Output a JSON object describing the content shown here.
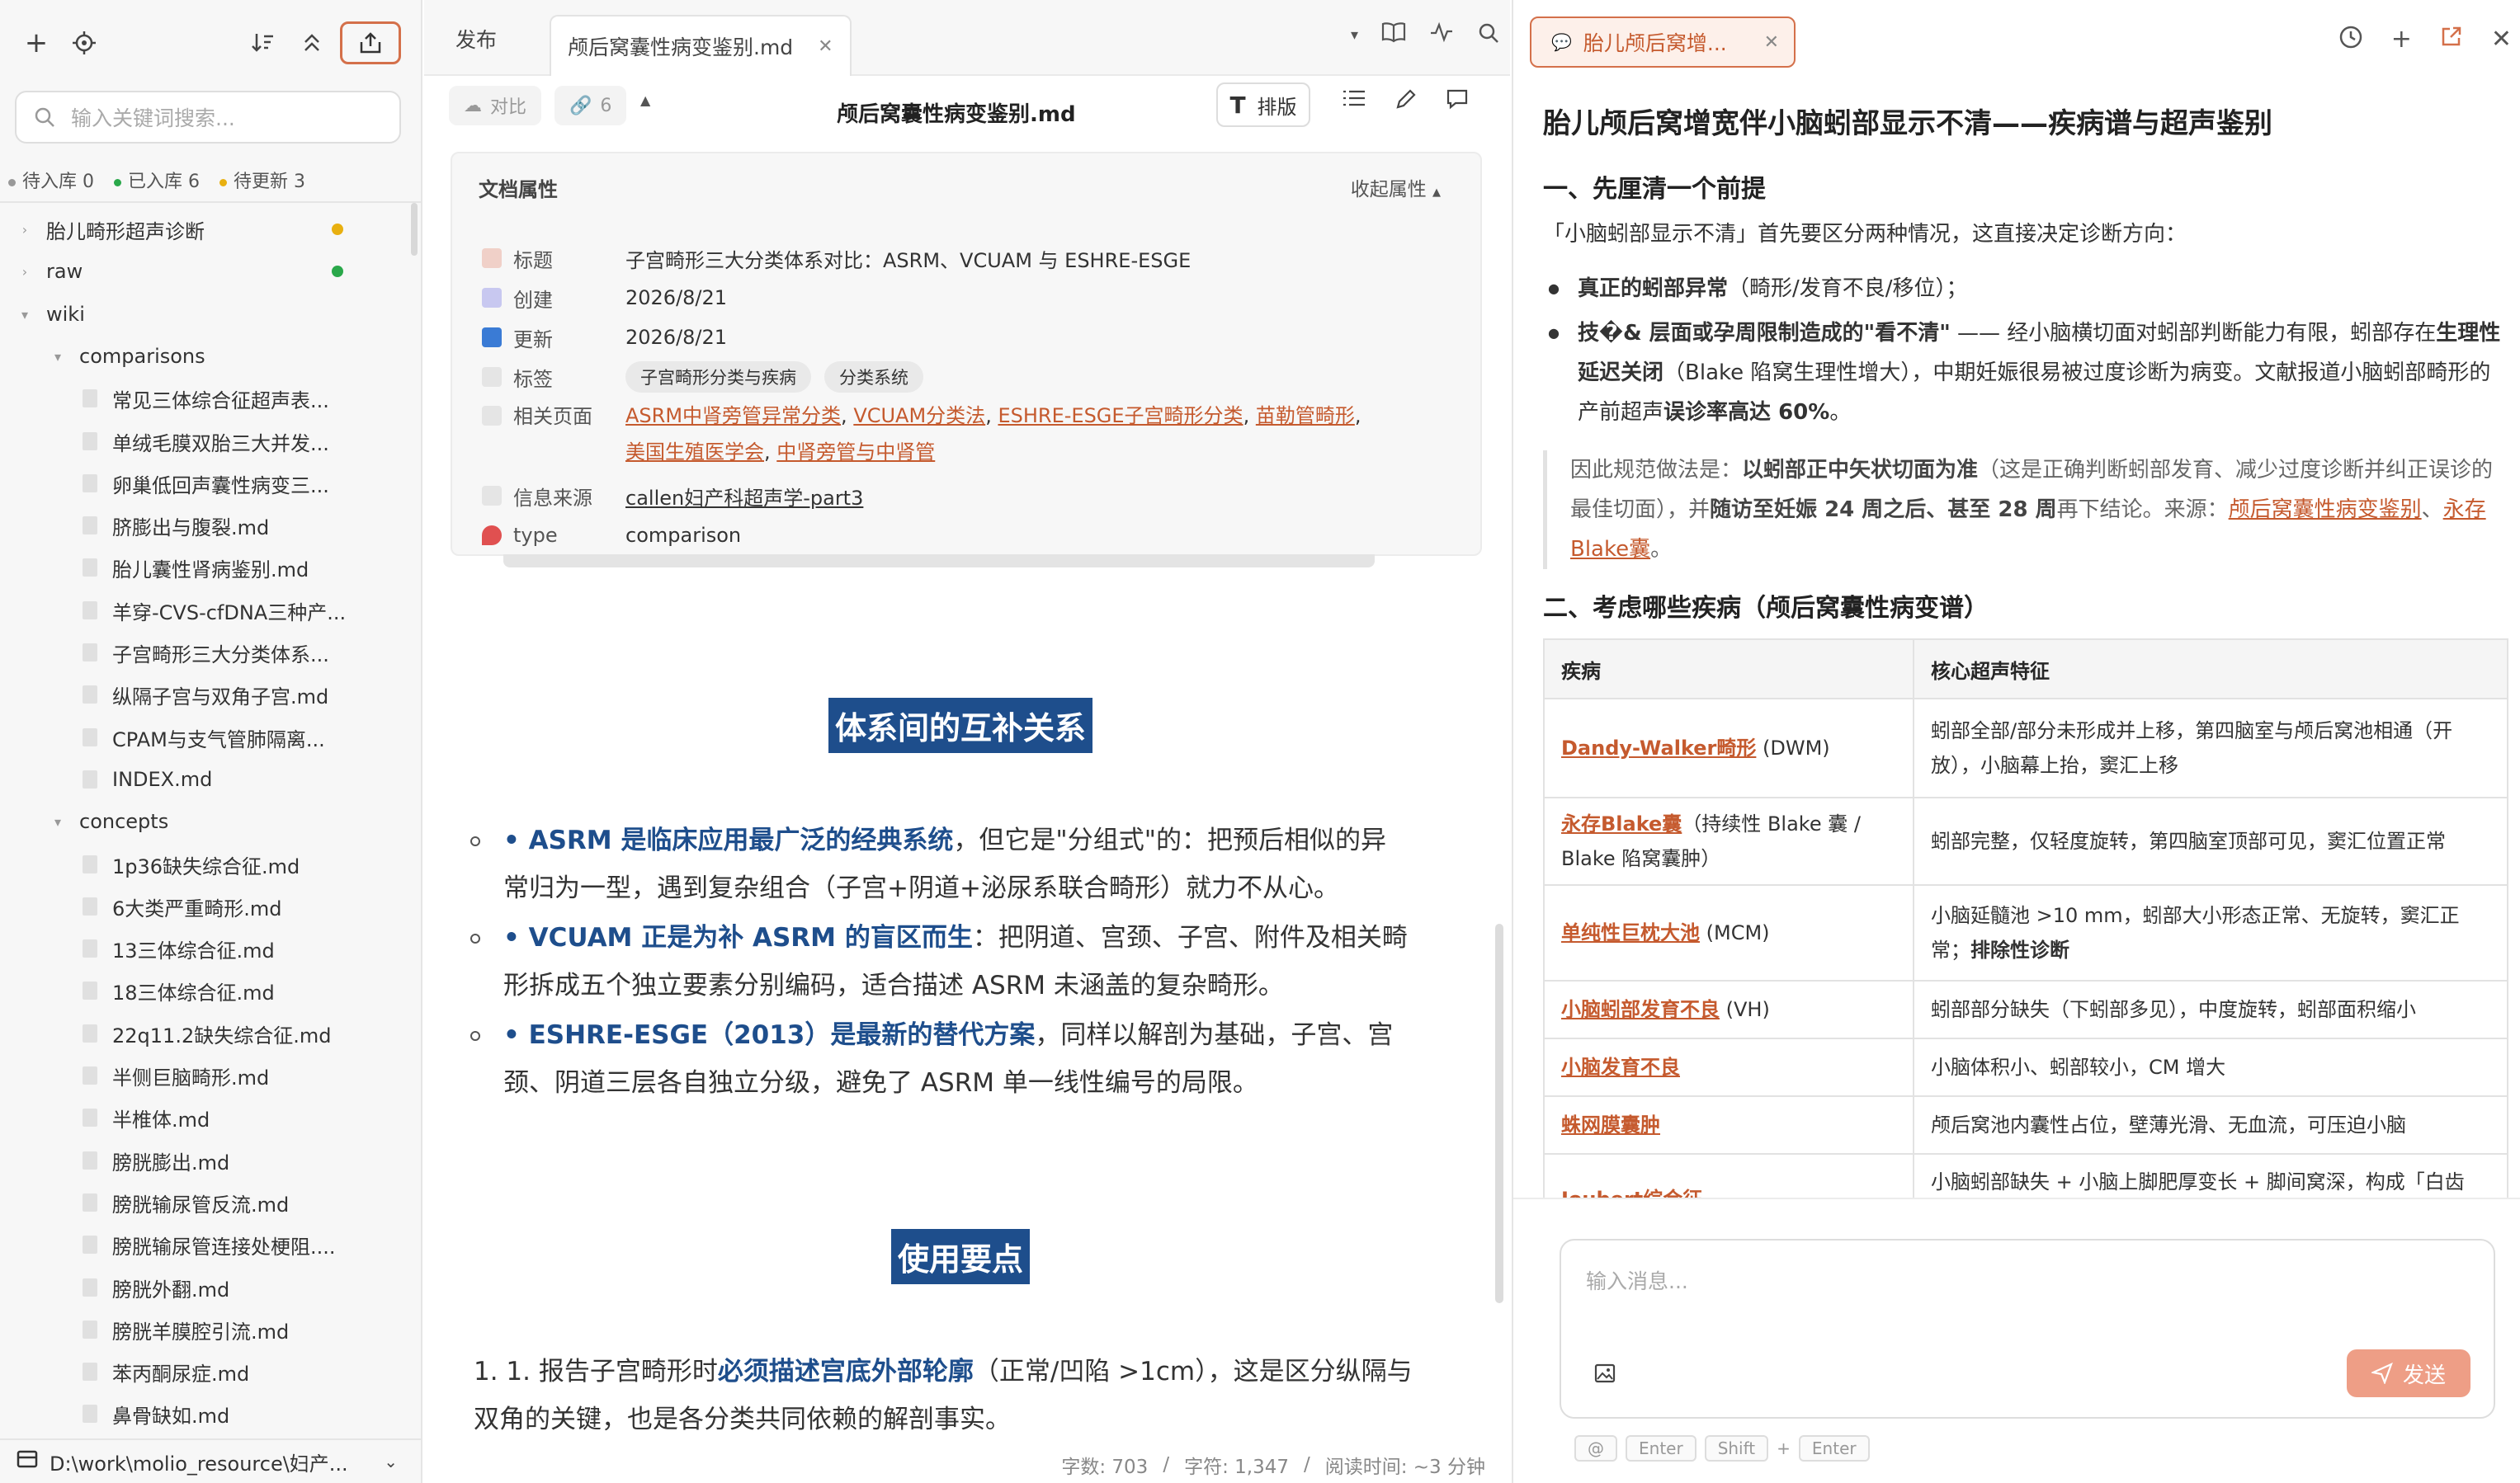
{
  "sidebar": {
    "search_placeholder": "输入关键词搜索...",
    "status": [
      {
        "label": "待入库 0",
        "color": "#999999"
      },
      {
        "label": "已入库 6",
        "color": "#2aa84a"
      },
      {
        "label": "待更新 3",
        "color": "#e8b010"
      }
    ],
    "tree": [
      {
        "label": "胎儿畸形超声诊断",
        "type": "folder",
        "depth": 0,
        "dot": "#e8b010"
      },
      {
        "label": "raw",
        "type": "folder",
        "depth": 0,
        "dot": "#2aa84a"
      },
      {
        "label": "wiki",
        "type": "folder-open",
        "depth": 0
      },
      {
        "label": "comparisons",
        "type": "folder-open",
        "depth": 1
      },
      {
        "label": "常见三体综合征超声表...",
        "type": "file",
        "depth": 2
      },
      {
        "label": "单绒毛膜双胎三大并发...",
        "type": "file",
        "depth": 2
      },
      {
        "label": "卵巢低回声囊性病变三...",
        "type": "file",
        "depth": 2
      },
      {
        "label": "脐膨出与腹裂.md",
        "type": "file",
        "depth": 2
      },
      {
        "label": "胎儿囊性肾病鉴别.md",
        "type": "file",
        "depth": 2
      },
      {
        "label": "羊穿-CVS-cfDNA三种产...",
        "type": "file",
        "depth": 2
      },
      {
        "label": "子宫畸形三大分类体系...",
        "type": "file",
        "depth": 2
      },
      {
        "label": "纵隔子宫与双角子宫.md",
        "type": "file",
        "depth": 2
      },
      {
        "label": "CPAM与支气管肺隔离...",
        "type": "file",
        "depth": 2
      },
      {
        "label": "INDEX.md",
        "type": "file",
        "depth": 2
      },
      {
        "label": "concepts",
        "type": "folder-open",
        "depth": 1
      },
      {
        "label": "1p36缺失综合征.md",
        "type": "file",
        "depth": 2
      },
      {
        "label": "6大类严重畸形.md",
        "type": "file",
        "depth": 2
      },
      {
        "label": "13三体综合征.md",
        "type": "file",
        "depth": 2
      },
      {
        "label": "18三体综合征.md",
        "type": "file",
        "depth": 2
      },
      {
        "label": "22q11.2缺失综合征.md",
        "type": "file",
        "depth": 2
      },
      {
        "label": "半侧巨脑畸形.md",
        "type": "file",
        "depth": 2
      },
      {
        "label": "半椎体.md",
        "type": "file",
        "depth": 2
      },
      {
        "label": "膀胱膨出.md",
        "type": "file",
        "depth": 2
      },
      {
        "label": "膀胱输尿管反流.md",
        "type": "file",
        "depth": 2
      },
      {
        "label": "膀胱输尿管连接处梗阻....",
        "type": "file",
        "depth": 2
      },
      {
        "label": "膀胱外翻.md",
        "type": "file",
        "depth": 2
      },
      {
        "label": "膀胱羊膜腔引流.md",
        "type": "file",
        "depth": 2
      },
      {
        "label": "苯丙酮尿症.md",
        "type": "file",
        "depth": 2
      },
      {
        "label": "鼻骨缺如.md",
        "type": "file",
        "depth": 2
      }
    ],
    "vault_path": "D:\\work\\molio_resource\\妇产..."
  },
  "editor": {
    "tabs": [
      {
        "label": "发布"
      },
      {
        "label": "颅后窝囊性病变鉴别.md"
      }
    ],
    "toolbar": {
      "compare": "对比",
      "link_count": "6",
      "doc_title": "颅后窝囊性病变鉴别.md",
      "layout": "排版"
    },
    "props": {
      "title": "文档属性",
      "collapse": "收起属性",
      "rows": {
        "title_key": "标题",
        "title_val": "子宫畸形三大分类体系对比：ASRM、VCUAM 与 ESHRE-ESGE",
        "created_key": "创建",
        "created_val": "2026/8/21",
        "updated_key": "更新",
        "updated_val": "2026/8/21",
        "tags_key": "标签",
        "tags": [
          "子宫畸形分类与疾病",
          "分类系统"
        ],
        "related_key": "相关页面",
        "related": [
          "ASRM中肾旁管异常分类",
          "VCUAM分类法",
          "ESHRE-ESGE子宫畸形分类",
          "苗勒管畸形",
          "美国生殖医学会",
          "中肾旁管与中肾管"
        ],
        "source_key": "信息来源",
        "source_val": "callen妇产科超声学-part3",
        "type_key": "type",
        "type_val": "comparison"
      }
    },
    "section1": "体系间的互补关系",
    "bullets": [
      {
        "bold": "• ASRM 是临床应用最广泛的经典系统",
        "rest": "，但它是\"分组式\"的：把预后相似的异常归为一型，遇到复杂组合（子宫+阴道+泌尿系联合畸形）就力不从心。"
      },
      {
        "bold": "• VCUAM 正是为补 ASRM 的盲区而生",
        "rest": "：把阴道、宫颈、子宫、附件及相关畸形拆成五个独立要素分别编码，适合描述 ASRM 未涵盖的复杂畸形。"
      },
      {
        "bold": "• ESHRE-ESGE（2013）是最新的替代方案",
        "rest": "，同样以解剖为基础，子宫、宫颈、阴道三层各自独立分级，避免了 ASRM 单一线性编号的局限。"
      }
    ],
    "section2": "使用要点",
    "numbered": [
      {
        "pre": "1. 1. 报告子宫畸形时",
        "bold": "必须描述宫底外部轮廓",
        "rest": "（正常/凹陷 >1cm），这是区分纵隔与双角的关键，也是各分类共同依赖的解剖事实。"
      }
    ],
    "footer": {
      "words": "字数: 703",
      "chars": "字符: 1,347",
      "read": "阅读时间: ~3 分钟"
    }
  },
  "chat": {
    "tab_label": "胎儿颅后窝增...",
    "h1": "胎儿颅后窝增宽伴小脑蚓部显示不清——疾病谱与超声鉴别",
    "s1": "一、先厘清一个前提",
    "p1": "「小脑蚓部显示不清」首先要区分两种情况，这直接决定诊断方向：",
    "li1_bold": "真正的蚓部异常",
    "li1_rest": "（畸形/发育不良/移位）；",
    "li2_bold": "技�& 层面或孕周限制造成的\"看不清\"",
    "li2_rest": " —— 经小脑横切面对蚓部判断能力有限，蚓部存在",
    "li2_bold2": "生理性延迟关闭",
    "li2_rest2": "（Blake 陷窝生理性增大），中期妊娠很易被过度诊断为病变。文献报道小脑蚓部畸形的产前超声",
    "li2_bold3": "误诊率高达 60%",
    "li2_end": "。",
    "quote_pre": "因此规范做法是：",
    "quote_bold1": "以蚓部正中矢状切面为准",
    "quote_mid": "（这是正确判断蚓部发育、减少过度诊断并纠正误诊的最佳切面），并",
    "quote_bold2": "随访至妊娠 24 周之后、甚至 28 周",
    "quote_mid2": "再下结论。来源：",
    "quote_link1": "颅后窝囊性病变鉴别",
    "quote_sep": "、",
    "quote_link2": "永存Blake囊",
    "quote_end": "。",
    "s2": "二、考虑哪些疾病（颅后窝囊性病变谱）",
    "table_head": [
      "疾病",
      "核心超声特征"
    ],
    "table_rows": [
      {
        "link": "Dandy-Walker畸形",
        "extra": " (DWM)",
        "feat": "蚓部全部/部分未形成并上移，第四脑室与颅后窝池相通（开放），小脑幕上抬，窦汇上移"
      },
      {
        "link": "永存Blake囊",
        "extra": "（持续性 Blake 囊 / Blake 陷窝囊肿）",
        "feat": "蚓部完整，仅轻度旋转，第四脑室顶部可见，窦汇位置正常"
      },
      {
        "link": "单纯性巨枕大池",
        "extra": " (MCM)",
        "feat": "小脑延髓池 >10 mm，蚓部大小形态正常、无旋转，窦汇正常；",
        "feat_bold": "排除性诊断"
      },
      {
        "link": "小脑蚓部发育不良",
        "extra": " (VH)",
        "feat": "蚓部部分缺失（下蚓部多见），中度旋转，蚓部面积缩小"
      },
      {
        "link": "小脑发育不良",
        "extra": "",
        "feat": "小脑体积小、蚓部较小，CM 增大"
      },
      {
        "link": "蛛网膜囊肿",
        "extra": "",
        "feat": "颅后窝池内囊性占位，壁薄光滑、无血流，可压迫小脑"
      },
      {
        "link": "Joubert综合征",
        "extra": "",
        "feat": "小脑蚓部缺失 + 小脑上脚肥厚变长 + 脚间窝深，构成「白齿征」等征"
      }
    ],
    "input_placeholder": "输入消息...",
    "send": "发送",
    "hints": [
      "@",
      "Enter",
      "Shift",
      "+",
      "Enter"
    ]
  }
}
